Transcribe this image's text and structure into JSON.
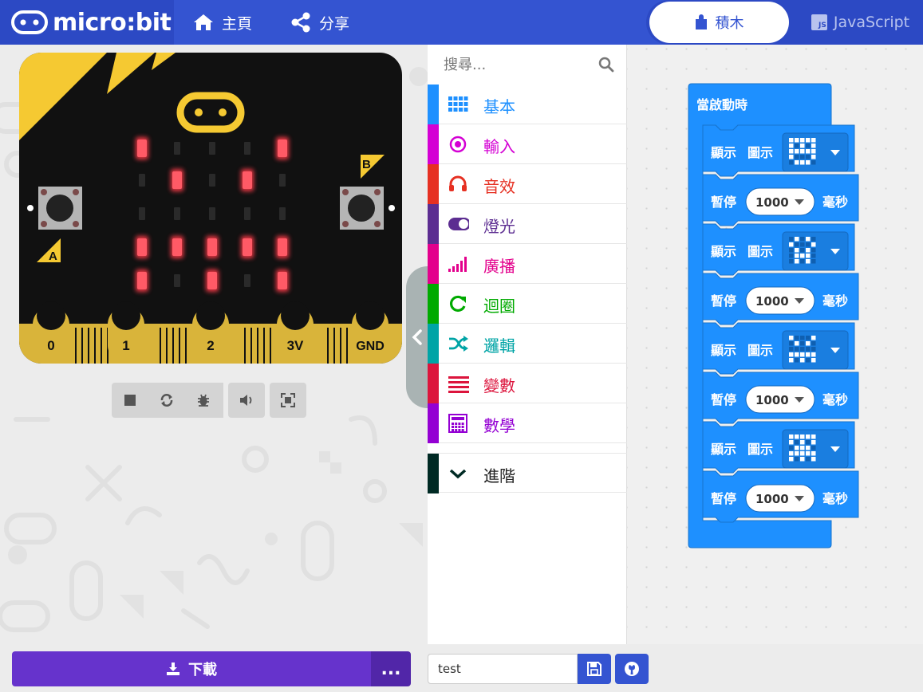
{
  "header": {
    "logo_text": "micro:bit",
    "nav_home": "主頁",
    "nav_share": "分享",
    "tab_blocks": "積木",
    "tab_js": "JavaScript",
    "js_badge": "JS"
  },
  "simulator": {
    "pins": [
      "0",
      "1",
      "2",
      "3V",
      "GND"
    ],
    "button_a": "A",
    "button_b": "B",
    "led_matrix": [
      [
        1,
        0,
        0,
        0,
        1
      ],
      [
        0,
        1,
        0,
        1,
        0
      ],
      [
        0,
        0,
        0,
        0,
        0
      ],
      [
        1,
        1,
        1,
        1,
        1
      ],
      [
        1,
        0,
        1,
        0,
        1
      ]
    ],
    "led_color": "#ff3b4a"
  },
  "search": {
    "placeholder": "搜尋..."
  },
  "categories": [
    {
      "label": "基本",
      "color": "#1e90ff",
      "icon": "grid-icon"
    },
    {
      "label": "輸入",
      "color": "#d400d4",
      "icon": "target-icon"
    },
    {
      "label": "音效",
      "color": "#e63022",
      "icon": "headphones-icon"
    },
    {
      "label": "燈光",
      "color": "#5c2d91",
      "icon": "toggle-icon"
    },
    {
      "label": "廣播",
      "color": "#e3008c",
      "icon": "signal-icon"
    },
    {
      "label": "迴圈",
      "color": "#00aa00",
      "icon": "loop-icon"
    },
    {
      "label": "邏輯",
      "color": "#00a4a6",
      "icon": "shuffle-icon"
    },
    {
      "label": "變數",
      "color": "#dc143c",
      "icon": "list-icon"
    },
    {
      "label": "數學",
      "color": "#9400d3",
      "icon": "calculator-icon"
    },
    {
      "label": "進階",
      "color": "#002a24",
      "icon": "chevron-down-icon"
    }
  ],
  "workspace": {
    "hat_label": "當啟動時",
    "show_label": "顯示",
    "icon_label": "圖示",
    "pause_label": "暫停",
    "ms_label": "毫秒",
    "block_color": "#1e90ff",
    "steps": [
      {
        "type": "show",
        "icon": [
          [
            1,
            1,
            1,
            1,
            1
          ],
          [
            1,
            0,
            1,
            0,
            1
          ],
          [
            1,
            1,
            1,
            1,
            1
          ],
          [
            1,
            0,
            0,
            0,
            1
          ],
          [
            0,
            1,
            1,
            1,
            0
          ]
        ]
      },
      {
        "type": "pause",
        "value": "1000"
      },
      {
        "type": "show",
        "icon": [
          [
            0,
            1,
            0,
            1,
            0
          ],
          [
            1,
            0,
            0,
            0,
            1
          ],
          [
            0,
            1,
            0,
            1,
            0
          ],
          [
            0,
            1,
            1,
            1,
            0
          ],
          [
            0,
            1,
            0,
            1,
            0
          ]
        ]
      },
      {
        "type": "pause",
        "value": "1000"
      },
      {
        "type": "show",
        "icon": [
          [
            1,
            0,
            0,
            0,
            1
          ],
          [
            0,
            1,
            0,
            1,
            0
          ],
          [
            0,
            0,
            0,
            0,
            0
          ],
          [
            1,
            1,
            1,
            1,
            1
          ],
          [
            1,
            0,
            1,
            0,
            1
          ]
        ]
      },
      {
        "type": "pause",
        "value": "1000"
      },
      {
        "type": "show",
        "icon": [
          [
            1,
            1,
            1,
            1,
            1
          ],
          [
            1,
            0,
            1,
            0,
            1
          ],
          [
            0,
            1,
            1,
            1,
            0
          ],
          [
            1,
            1,
            1,
            1,
            1
          ],
          [
            1,
            0,
            1,
            0,
            1
          ]
        ]
      },
      {
        "type": "pause",
        "value": "1000"
      }
    ]
  },
  "footer": {
    "download_label": "下載",
    "more_label": "...",
    "project_name": "test"
  }
}
